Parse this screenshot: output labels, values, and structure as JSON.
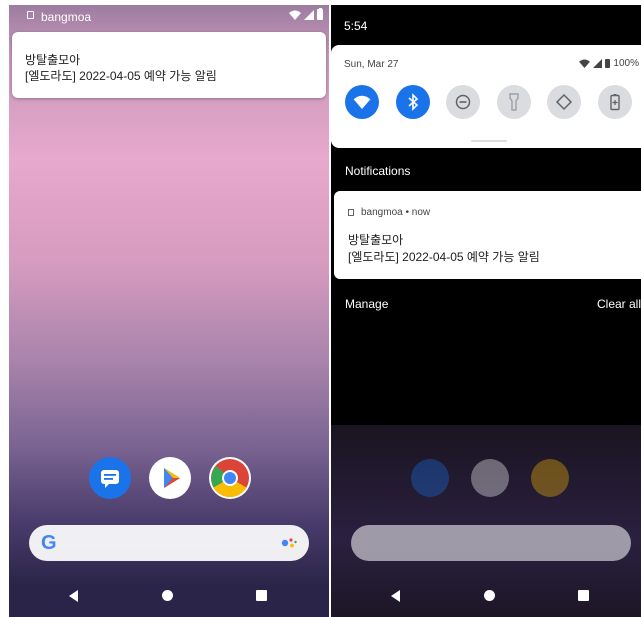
{
  "left": {
    "statusbar": {
      "app_name": "bangmoa"
    },
    "headsup": {
      "title": "방탈출모아",
      "message": "[엘도라도] 2022-04-05 예약 가능 알림"
    }
  },
  "right": {
    "statusbar": {
      "time": "5:54"
    },
    "quick_settings": {
      "date": "Sun, Mar 27",
      "battery": "100%"
    },
    "section_title": "Notifications",
    "notification": {
      "app_line": "bangmoa • now",
      "title": "방탈출모아",
      "message": "[엘도라도] 2022-04-05 예약 가능 알림"
    },
    "manage_label": "Manage",
    "clear_all_label": "Clear all"
  },
  "icons": [
    "wifi-icon",
    "bluetooth-icon",
    "dnd-icon",
    "flashlight-icon",
    "auto-rotate-icon",
    "battery-saver-icon"
  ],
  "colors": {
    "tile_on": "#1a73e8",
    "tile_off": "#dadce0"
  }
}
